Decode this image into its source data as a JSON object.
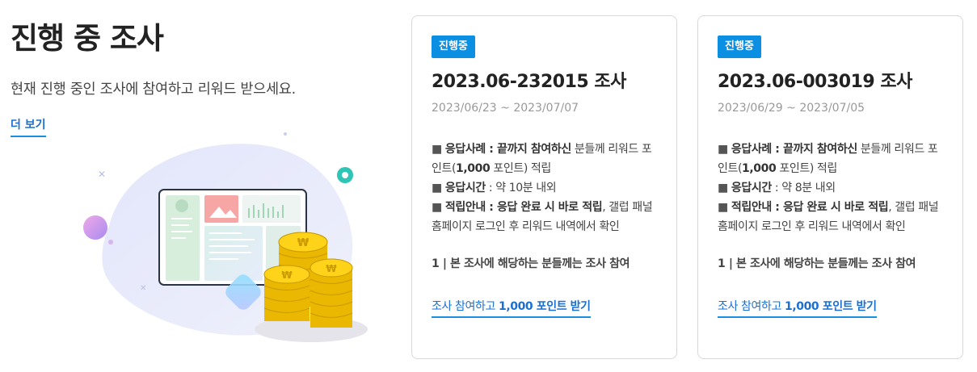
{
  "intro": {
    "title": "진행 중 조사",
    "description": "현재 진행 중인 조사에 참여하고 리워드 받으세요.",
    "more_label": "더 보기"
  },
  "colors": {
    "accent": "#0b8fe3",
    "link": "#1a6fd0",
    "coin": "#f3c300"
  },
  "surveys": [
    {
      "badge": "진행중",
      "title": "2023.06-232015 조사",
      "period": "2023/06/23 ~ 2023/07/07",
      "bullet": "■",
      "response_label": "응답사례",
      "response_sep": " : ",
      "response_bold": "끝까지 참여하신",
      "response_rest": " 분들께 리워드 포인트(",
      "response_points": "1,000",
      "response_tail": " 포인트) 적립",
      "time_label": "응답시간",
      "time_text": " : 약 10분 내외",
      "guide_label": "적립안내",
      "guide_sep": " : ",
      "guide_bold": "응답 완료 시 바로 적립",
      "guide_rest": ", 갤럽 패널 홈페이지 로그인 후 리워드 내역에서 확인",
      "target": "1 | 본 조사에 해당하는 분들께는 조사 참여",
      "cta_prefix": "조사 참여하고 ",
      "cta_bold": "1,000 포인트 받기"
    },
    {
      "badge": "진행중",
      "title": "2023.06-003019 조사",
      "period": "2023/06/29 ~ 2023/07/05",
      "bullet": "■",
      "response_label": "응답사례",
      "response_sep": " : ",
      "response_bold": "끝까지 참여하신",
      "response_rest": " 분들께 리워드 포인트(",
      "response_points": "1,000",
      "response_tail": " 포인트) 적립",
      "time_label": "응답시간",
      "time_text": " : 약 8분 내외",
      "guide_label": "적립안내",
      "guide_sep": " : ",
      "guide_bold": "응답 완료 시 바로 적립",
      "guide_rest": ", 갤럽 패널 홈페이지 로그인 후 리워드 내역에서 확인",
      "target": "1 | 본 조사에 해당하는 분들께는 조사 참여",
      "cta_prefix": "조사 참여하고 ",
      "cta_bold": "1,000 포인트 받기"
    }
  ],
  "illustration": {
    "coin_symbol": "₩"
  }
}
